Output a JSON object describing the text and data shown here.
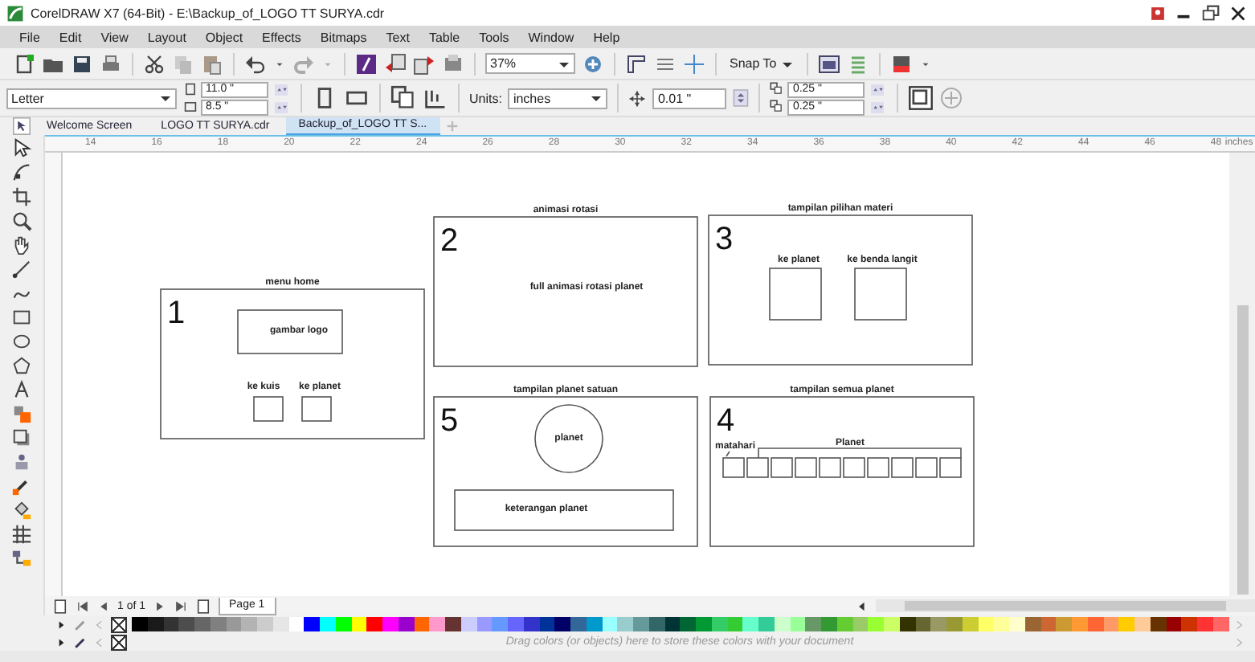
{
  "window": {
    "title": "CorelDRAW X7 (64-Bit) - E:\\Backup_of_LOGO TT SURYA.cdr"
  },
  "menu": [
    "File",
    "Edit",
    "View",
    "Layout",
    "Object",
    "Effects",
    "Bitmaps",
    "Text",
    "Table",
    "Tools",
    "Window",
    "Help"
  ],
  "toolbar": {
    "zoom": "37%",
    "snap": "Snap To"
  },
  "property_bar": {
    "page_size": "Letter",
    "width": "11.0 \"",
    "height": "8.5 \"",
    "units_label": "Units:",
    "units": "inches",
    "nudge": "0.01 \"",
    "duplicate_x": "0.25 \"",
    "duplicate_y": "0.25 \""
  },
  "document_tabs": [
    {
      "label": "Welcome Screen",
      "selected": false
    },
    {
      "label": "LOGO TT SURYA.cdr",
      "selected": false
    },
    {
      "label": "Backup_of_LOGO TT S...",
      "selected": true
    }
  ],
  "ruler": {
    "labels": [
      "14",
      "16",
      "18",
      "20",
      "22",
      "24",
      "26",
      "28",
      "30",
      "32",
      "34",
      "36",
      "38",
      "40",
      "42",
      "44",
      "46",
      "48"
    ],
    "unit": "inches"
  },
  "frames": [
    {
      "kind": "home",
      "number": "1",
      "title": "menu home",
      "logo": "gambar logo",
      "buttons": [
        "ke kuis",
        "ke planet"
      ]
    },
    {
      "kind": "animation",
      "number": "2",
      "title": "animasi rotasi",
      "text": "full animasi rotasi planet"
    },
    {
      "kind": "choice",
      "number": "3",
      "title": "tampilan pilihan materi",
      "options": [
        "ke planet",
        "ke benda langit"
      ]
    },
    {
      "kind": "single",
      "number": "5",
      "title": "tampilan planet satuan",
      "planet": "planet",
      "panel": "keterangan planet"
    },
    {
      "kind": "all",
      "number": "4",
      "title": "tampilan semua planet",
      "sun": "matahari",
      "group": "Planet"
    }
  ],
  "page_navigator": {
    "position": "1 of 1",
    "pages": [
      {
        "label": "Page 1",
        "selected": true
      }
    ]
  },
  "palette": {
    "swatches": [
      {
        "color": "#000000"
      },
      {
        "color": "#1a1a1a"
      },
      {
        "color": "#333333"
      },
      {
        "color": "#4d4d4d"
      },
      {
        "color": "#666666"
      },
      {
        "color": "#808080"
      },
      {
        "color": "#999999"
      },
      {
        "color": "#b3b3b3"
      },
      {
        "color": "#cccccc"
      },
      {
        "color": "#e6e6e6"
      },
      {
        "color": "#ffffff"
      },
      {
        "color": "#0000ff"
      },
      {
        "color": "#00ffff"
      },
      {
        "color": "#00ff00"
      },
      {
        "color": "#ffff00"
      },
      {
        "color": "#ff0000"
      },
      {
        "color": "#ff00ff"
      },
      {
        "color": "#9900cc"
      },
      {
        "color": "#ff6600"
      },
      {
        "color": "#ff99cc"
      },
      {
        "color": "#663333"
      },
      {
        "color": "#ccccff"
      },
      {
        "color": "#9999ff"
      },
      {
        "color": "#6699ff"
      },
      {
        "color": "#6666ff"
      },
      {
        "color": "#3333cc"
      },
      {
        "color": "#003399"
      },
      {
        "color": "#000066"
      },
      {
        "color": "#336699"
      },
      {
        "color": "#0099cc"
      },
      {
        "color": "#99ffff"
      },
      {
        "color": "#99cccc"
      },
      {
        "color": "#669999"
      },
      {
        "color": "#336666"
      },
      {
        "color": "#003333"
      },
      {
        "color": "#006633"
      },
      {
        "color": "#009933"
      },
      {
        "color": "#33cc66"
      },
      {
        "color": "#33cc33"
      },
      {
        "color": "#66ffcc"
      },
      {
        "color": "#33cc99"
      },
      {
        "color": "#ccffcc"
      },
      {
        "color": "#99ff99"
      },
      {
        "color": "#669966"
      },
      {
        "color": "#339933"
      },
      {
        "color": "#66cc33"
      },
      {
        "color": "#99cc66"
      },
      {
        "color": "#99ff33"
      },
      {
        "color": "#ccff66"
      },
      {
        "color": "#333300"
      },
      {
        "color": "#666633"
      },
      {
        "color": "#999966"
      },
      {
        "color": "#999933"
      },
      {
        "color": "#cccc33"
      },
      {
        "color": "#ffff66"
      },
      {
        "color": "#ffff99"
      },
      {
        "color": "#ffffcc"
      },
      {
        "color": "#996633"
      },
      {
        "color": "#cc6633"
      },
      {
        "color": "#cc9933"
      },
      {
        "color": "#ff9933"
      },
      {
        "color": "#ff6633"
      },
      {
        "color": "#ff9966"
      },
      {
        "color": "#ffcc00"
      },
      {
        "color": "#ffcc99"
      },
      {
        "color": "#663300"
      },
      {
        "color": "#990000"
      },
      {
        "color": "#cc3300"
      },
      {
        "color": "#ff3333"
      },
      {
        "color": "#ff6666"
      }
    ]
  },
  "document_palette": {
    "hint": "Drag colors (or objects) here to store these colors with your document"
  }
}
